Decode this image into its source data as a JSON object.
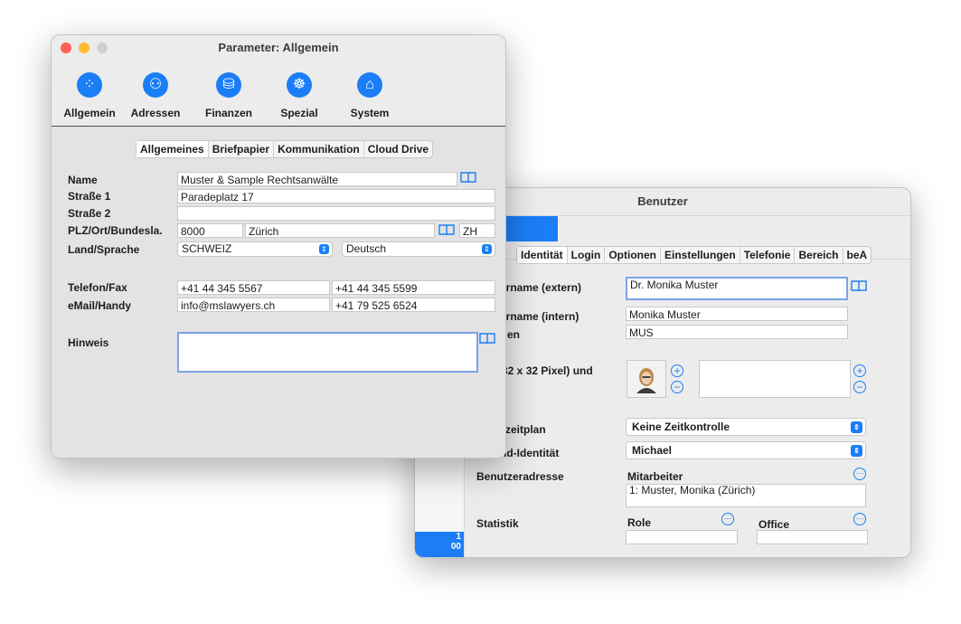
{
  "benutzer_window": {
    "title": "Benutzer",
    "sidebar_bottom_lines": [
      "1",
      "00"
    ],
    "tabs": [
      "Identität",
      "Login",
      "Optionen",
      "Einstellungen",
      "Telefonie",
      "Bereich",
      "beA"
    ],
    "labels": {
      "name_extern": "zername (extern)",
      "name_intern": "zername (intern)",
      "kuerzel": "en",
      "bild": "32 x 32 Pixel) und",
      "zeitplan": "zeitplan",
      "identitaet": "nd-Identität",
      "adresse": "Benutzeradresse",
      "statistik": "Statistik",
      "mitarbeiter": "Mitarbeiter",
      "role": "Role",
      "office": "Office"
    },
    "values": {
      "name_extern": "Dr. Monika Muster",
      "name_intern": "Monika Muster",
      "kuerzel": "MUS",
      "zeitplan": "Keine Zeitkontrolle",
      "identitaet": "Michael",
      "adresse": "1: Muster, Monika (Zürich)",
      "role": "",
      "office": ""
    },
    "avatar_icon": "person-photo-icon"
  },
  "parameter_window": {
    "title": "Parameter: Allgemein",
    "traffic_lights": {
      "close": "#fe5f57",
      "minimize": "#febc2e",
      "zoom": "#d0d0d0"
    },
    "toolbar": [
      {
        "label": "Allgemein",
        "icon": "gauge-icon",
        "glyph": "⁘"
      },
      {
        "label": "Adressen",
        "icon": "people-icon",
        "glyph": "⚇"
      },
      {
        "label": "Finanzen",
        "icon": "coins-icon",
        "glyph": "⛁"
      },
      {
        "label": "Spezial",
        "icon": "helm-icon",
        "glyph": "☸"
      },
      {
        "label": "System",
        "icon": "house-icon",
        "glyph": "⌂"
      }
    ],
    "tabs": [
      "Allgemeines",
      "Briefpapier",
      "Kommunikation",
      "Cloud Drive"
    ],
    "labels": {
      "name": "Name",
      "strasse1": "Straße 1",
      "strasse2": "Straße 2",
      "plz": "PLZ/Ort/Bundesla.",
      "land": "Land/Sprache",
      "telefon": "Telefon/Fax",
      "email": "eMail/Handy",
      "hinweis": "Hinweis"
    },
    "values": {
      "name": "Muster & Sample Rechtsanwälte",
      "strasse1": "Paradeplatz 17",
      "strasse2": "",
      "plz": "8000",
      "ort": "Zürich",
      "bundesland": "ZH",
      "land": "SCHWEIZ",
      "sprache": "Deutsch",
      "telefon": "+41 44 345 5567",
      "fax": "+41 44 345 5599",
      "email": "info@mslawyers.ch",
      "handy": "+41 79 525 6524",
      "hinweis": ""
    }
  },
  "colors": {
    "accent": "#1b7ef6"
  }
}
